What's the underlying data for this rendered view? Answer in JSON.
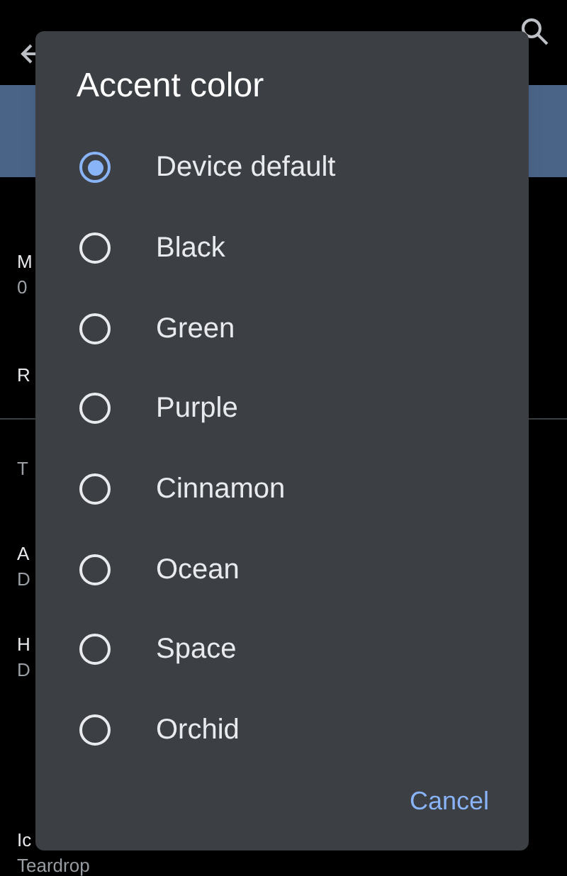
{
  "background": {
    "items": [
      {
        "title": "M",
        "subtitle": "0"
      },
      {
        "title": "R"
      },
      {
        "section": "T"
      },
      {
        "title": "A",
        "subtitle": "D"
      },
      {
        "title": "H",
        "subtitle": "D"
      },
      {
        "title": "Ic",
        "subtitle": "Teardrop"
      }
    ]
  },
  "dialog": {
    "title": "Accent color",
    "options": [
      {
        "label": "Device default",
        "selected": true
      },
      {
        "label": "Black",
        "selected": false
      },
      {
        "label": "Green",
        "selected": false
      },
      {
        "label": "Purple",
        "selected": false
      },
      {
        "label": "Cinnamon",
        "selected": false
      },
      {
        "label": "Ocean",
        "selected": false
      },
      {
        "label": "Space",
        "selected": false
      },
      {
        "label": "Orchid",
        "selected": false
      }
    ],
    "buttons": [
      "Cancel"
    ]
  }
}
